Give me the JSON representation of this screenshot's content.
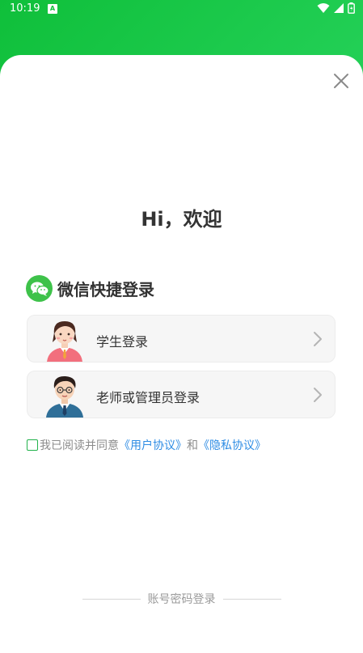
{
  "status_bar": {
    "time": "10:19",
    "notification_glyph": "A",
    "icons": [
      "wifi-icon",
      "signal-icon",
      "battery-icon"
    ]
  },
  "greeting": "Hi，欢迎",
  "wechat_section": {
    "icon": "wechat-icon",
    "title": "微信快捷登录",
    "options": [
      {
        "label": "学生登录",
        "avatar": "student-avatar"
      },
      {
        "label": "老师或管理员登录",
        "avatar": "teacher-avatar"
      }
    ]
  },
  "agreement": {
    "checked": false,
    "prefix": "我已阅读并同意",
    "user_agreement": "《用户协议》",
    "conjunction": "和",
    "privacy_agreement": "《隐私协议》"
  },
  "alt_login": {
    "label": "账号密码登录"
  },
  "colors": {
    "brand_green": "#1ec84e",
    "link_blue": "#2f8de4",
    "checkbox_green": "#22b24c"
  }
}
